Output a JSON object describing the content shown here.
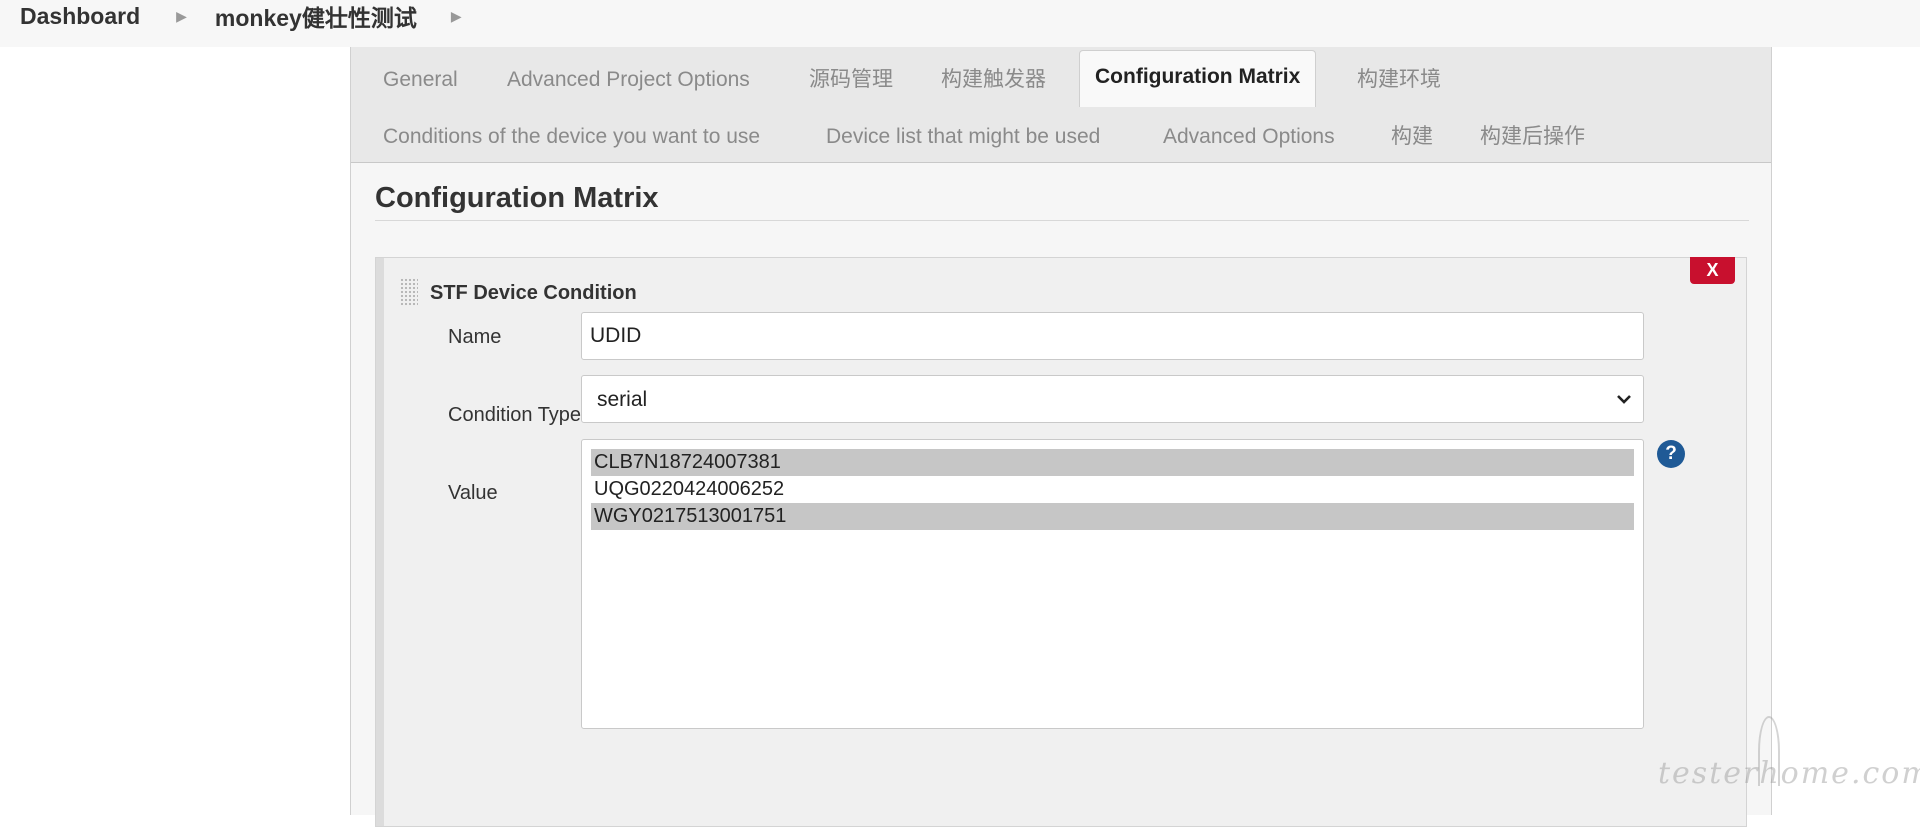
{
  "breadcrumb": {
    "items": [
      "Dashboard",
      "monkey健壮性测试"
    ],
    "separator_icon": "chevron-right-icon"
  },
  "tabs": [
    {
      "label": "General",
      "active": false
    },
    {
      "label": "Advanced Project Options",
      "active": false
    },
    {
      "label": "源码管理",
      "active": false
    },
    {
      "label": "构建触发器",
      "active": false
    },
    {
      "label": "Configuration Matrix",
      "active": true
    },
    {
      "label": "构建环境",
      "active": false
    },
    {
      "label": "Conditions of the device you want to use",
      "active": false
    },
    {
      "label": "Device list that might be used",
      "active": false
    },
    {
      "label": "Advanced Options",
      "active": false
    },
    {
      "label": "构建",
      "active": false
    },
    {
      "label": "构建后操作",
      "active": false
    }
  ],
  "section": {
    "title": "Configuration Matrix"
  },
  "condition": {
    "title": "STF Device Condition",
    "close_label": "X",
    "name_label": "Name",
    "name_value": "UDID",
    "type_label": "Condition Type",
    "type_value": "serial",
    "value_label": "Value",
    "options": [
      {
        "text": "CLB7N18724007381",
        "selected": true
      },
      {
        "text": "UQG0220424006252",
        "selected": false
      },
      {
        "text": "WGY0217513001751",
        "selected": true
      }
    ],
    "help_label": "?"
  },
  "watermark": "testerhome.com",
  "colors": {
    "close_button": "#c8102e",
    "help_icon": "#1f5a96",
    "selected_option": "#c6c6c6"
  }
}
